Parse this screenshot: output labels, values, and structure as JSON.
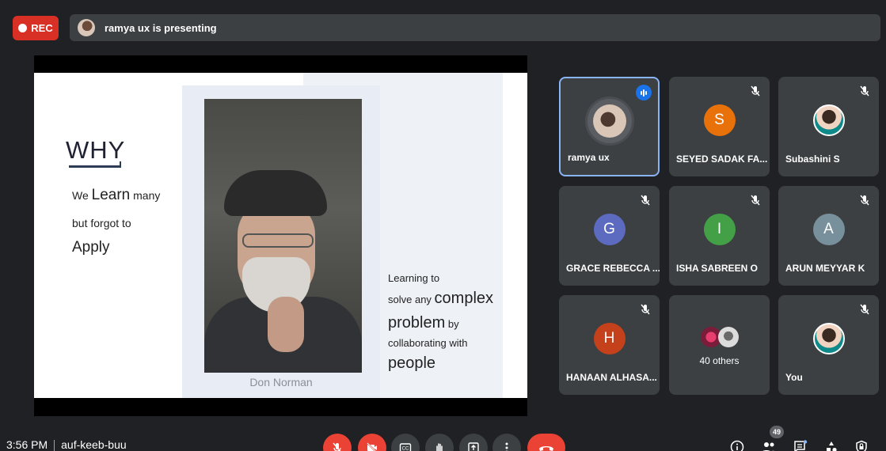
{
  "recording": {
    "label": "REC",
    "color": "#d93025"
  },
  "presenting_bar": {
    "text": "ramya ux is presenting"
  },
  "slide": {
    "heading": "WHY",
    "line1_pre": "We ",
    "line1_big": "Learn",
    "line1_post": " many",
    "line2": "but forgot to",
    "line3": "Apply",
    "quote": {
      "l1": "Learning to",
      "l2_pre": "solve any ",
      "l2_big": "complex",
      "l3_big": "problem",
      "l3_post": " by",
      "l4": "collaborating with",
      "l5": "people"
    },
    "caption": "Don Norman"
  },
  "participants": [
    {
      "name": "ramya ux",
      "avatar": "photo",
      "speaking": true,
      "active": true
    },
    {
      "name": "SEYED SADAK FA...",
      "initial": "S",
      "color": "#e8710a",
      "muted": true
    },
    {
      "name": "Subashini S",
      "avatar": "photo",
      "muted": true
    },
    {
      "name": "GRACE REBECCA ...",
      "initial": "G",
      "color": "#5c6bc0",
      "muted": true
    },
    {
      "name": "ISHA SABREEN O",
      "initial": "I",
      "color": "#43a047",
      "muted": true
    },
    {
      "name": "ARUN MEYYAR K",
      "initial": "A",
      "color": "#78909c",
      "muted": true
    },
    {
      "name": "HANAAN ALHASA...",
      "initial": "H",
      "color": "#c5411c",
      "muted": true
    },
    {
      "name": "40 others",
      "avatar": "group"
    },
    {
      "name": "You",
      "avatar": "photo",
      "muted": true
    }
  ],
  "bottom": {
    "time": "3:56 PM",
    "meeting_code": "auf-keeb-buu",
    "participant_count": "49"
  },
  "icons": {
    "mic_off": "mic-off-icon",
    "cam_off": "camera-off-icon",
    "captions": "captions-icon",
    "raise_hand": "raise-hand-icon",
    "present": "present-icon",
    "more": "more-vert-icon",
    "end_call": "end-call-icon",
    "info": "info-icon",
    "people": "people-icon",
    "chat": "chat-icon",
    "activities": "activities-icon",
    "host": "host-controls-icon"
  }
}
